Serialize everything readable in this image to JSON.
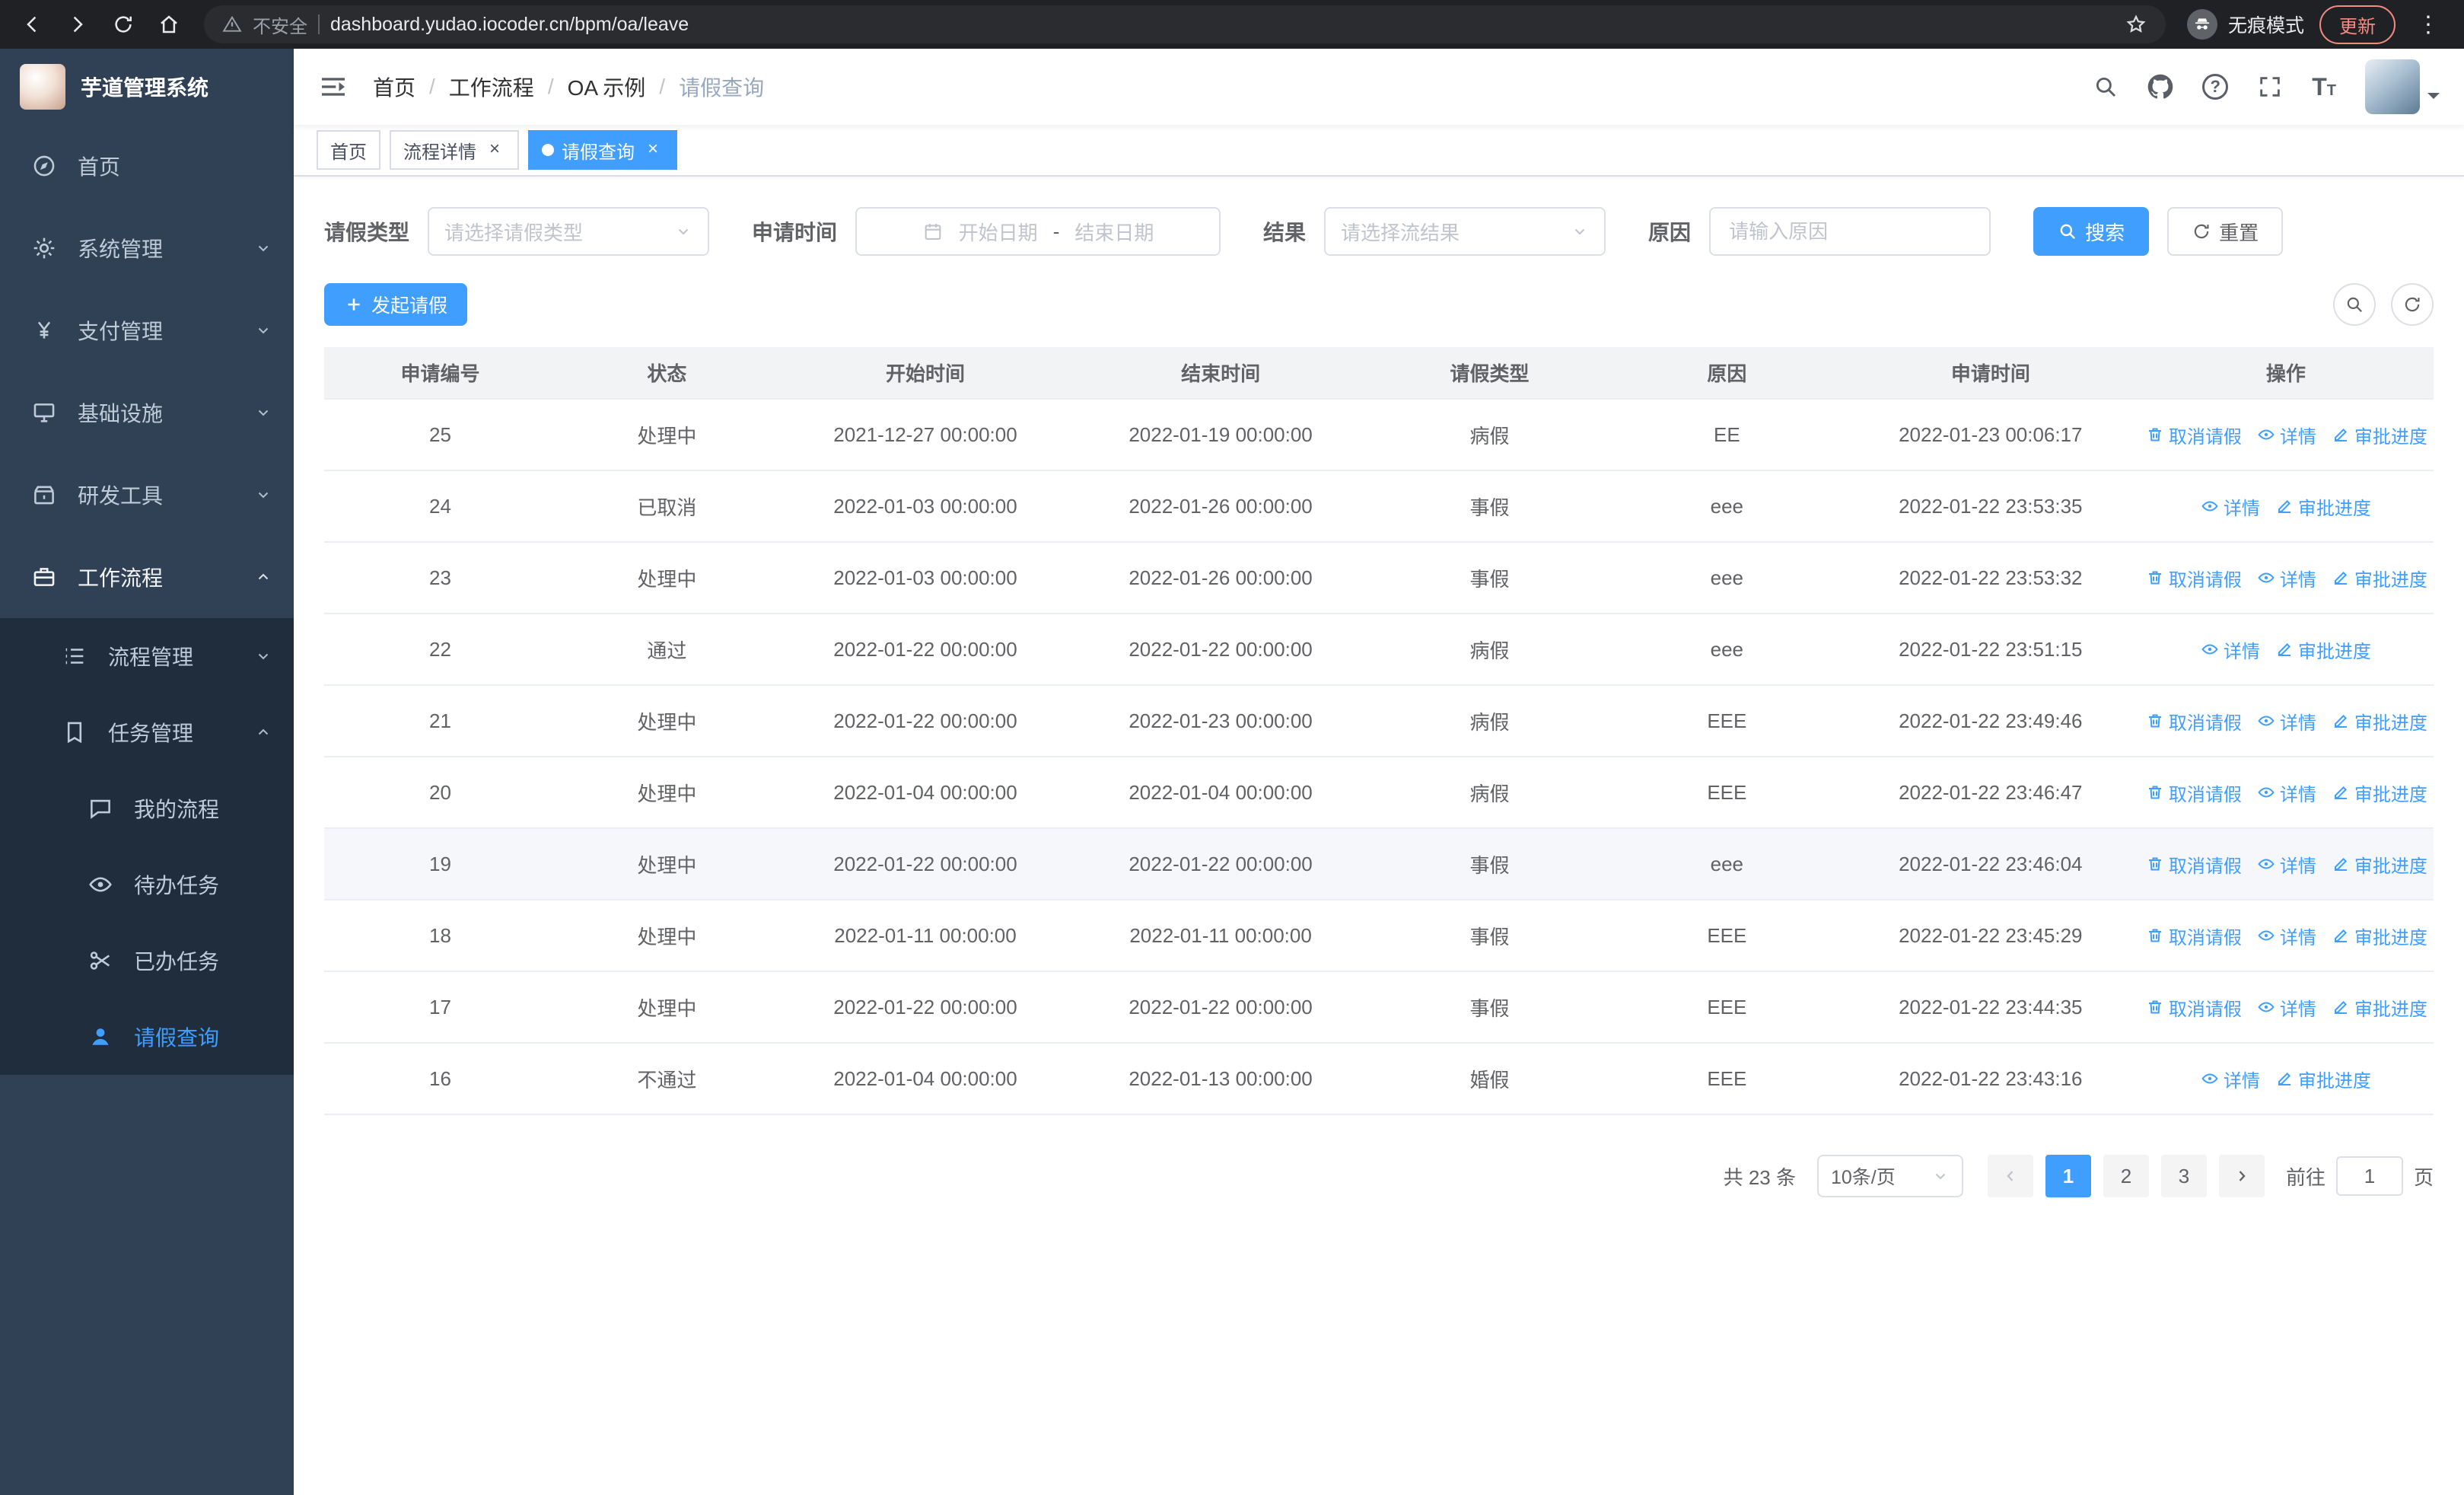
{
  "colors": {
    "primary": "#409EFF",
    "sidebar_bg": "#304156",
    "submenu_bg": "#1f2d3d"
  },
  "browser": {
    "security_warning": "不安全",
    "url": "dashboard.yudao.iocoder.cn/bpm/oa/leave",
    "incognito_label": "无痕模式",
    "update_button": "更新"
  },
  "sidebar": {
    "logo_title": "芋道管理系统",
    "items": [
      {
        "label": "首页",
        "level": 1,
        "icon": "home-icon"
      },
      {
        "label": "系统管理",
        "level": 1,
        "icon": "system-icon",
        "arrow": "down"
      },
      {
        "label": "支付管理",
        "level": 1,
        "icon": "payment-icon",
        "arrow": "down"
      },
      {
        "label": "基础设施",
        "level": 1,
        "icon": "infra-icon",
        "arrow": "down"
      },
      {
        "label": "研发工具",
        "level": 1,
        "icon": "devtools-icon",
        "arrow": "down"
      },
      {
        "label": "工作流程",
        "level": 1,
        "icon": "workflow-icon",
        "arrow": "up",
        "expanded": true
      },
      {
        "label": "流程管理",
        "level": 2,
        "icon": "process-icon",
        "arrow": "down"
      },
      {
        "label": "任务管理",
        "level": 2,
        "icon": "task-icon",
        "arrow": "up",
        "expanded": false
      },
      {
        "label": "我的流程",
        "level": 3,
        "icon": "my-process-icon"
      },
      {
        "label": "待办任务",
        "level": 3,
        "icon": "todo-icon"
      },
      {
        "label": "已办任务",
        "level": 3,
        "icon": "done-icon"
      },
      {
        "label": "请假查询",
        "level": 3,
        "icon": "leave-icon",
        "active": true
      }
    ]
  },
  "header": {
    "breadcrumbs": [
      "首页",
      "工作流程",
      "OA 示例",
      "请假查询"
    ]
  },
  "tabs": [
    {
      "label": "首页",
      "closable": false,
      "active": false
    },
    {
      "label": "流程详情",
      "closable": true,
      "active": false
    },
    {
      "label": "请假查询",
      "closable": true,
      "active": true
    }
  ],
  "filters": {
    "leave_type_label": "请假类型",
    "leave_type_placeholder": "请选择请假类型",
    "apply_time_label": "申请时间",
    "start_date_placeholder": "开始日期",
    "date_separator": "-",
    "end_date_placeholder": "结束日期",
    "result_label": "结果",
    "result_placeholder": "请选择流结果",
    "reason_label": "原因",
    "reason_placeholder": "请输入原因",
    "search_button": "搜索",
    "reset_button": "重置"
  },
  "toolbar": {
    "create_button": "发起请假"
  },
  "table": {
    "columns": [
      "申请编号",
      "状态",
      "开始时间",
      "结束时间",
      "请假类型",
      "原因",
      "申请时间",
      "操作"
    ],
    "action_labels": {
      "cancel": "取消请假",
      "detail": "详情",
      "progress": "审批进度"
    },
    "rows": [
      {
        "id": "25",
        "status": "处理中",
        "start": "2021-12-27 00:00:00",
        "end": "2022-01-19 00:00:00",
        "type": "病假",
        "reason": "EE",
        "apply_time": "2022-01-23 00:06:17",
        "actions": [
          "cancel",
          "detail",
          "progress"
        ],
        "highlight": false
      },
      {
        "id": "24",
        "status": "已取消",
        "start": "2022-01-03 00:00:00",
        "end": "2022-01-26 00:00:00",
        "type": "事假",
        "reason": "eee",
        "apply_time": "2022-01-22 23:53:35",
        "actions": [
          "detail",
          "progress"
        ],
        "highlight": false
      },
      {
        "id": "23",
        "status": "处理中",
        "start": "2022-01-03 00:00:00",
        "end": "2022-01-26 00:00:00",
        "type": "事假",
        "reason": "eee",
        "apply_time": "2022-01-22 23:53:32",
        "actions": [
          "cancel",
          "detail",
          "progress"
        ],
        "highlight": false
      },
      {
        "id": "22",
        "status": "通过",
        "start": "2022-01-22 00:00:00",
        "end": "2022-01-22 00:00:00",
        "type": "病假",
        "reason": "eee",
        "apply_time": "2022-01-22 23:51:15",
        "actions": [
          "detail",
          "progress"
        ],
        "highlight": false
      },
      {
        "id": "21",
        "status": "处理中",
        "start": "2022-01-22 00:00:00",
        "end": "2022-01-23 00:00:00",
        "type": "病假",
        "reason": "EEE",
        "apply_time": "2022-01-22 23:49:46",
        "actions": [
          "cancel",
          "detail",
          "progress"
        ],
        "highlight": false
      },
      {
        "id": "20",
        "status": "处理中",
        "start": "2022-01-04 00:00:00",
        "end": "2022-01-04 00:00:00",
        "type": "病假",
        "reason": "EEE",
        "apply_time": "2022-01-22 23:46:47",
        "actions": [
          "cancel",
          "detail",
          "progress"
        ],
        "highlight": false
      },
      {
        "id": "19",
        "status": "处理中",
        "start": "2022-01-22 00:00:00",
        "end": "2022-01-22 00:00:00",
        "type": "事假",
        "reason": "eee",
        "apply_time": "2022-01-22 23:46:04",
        "actions": [
          "cancel",
          "detail",
          "progress"
        ],
        "highlight": true
      },
      {
        "id": "18",
        "status": "处理中",
        "start": "2022-01-11 00:00:00",
        "end": "2022-01-11 00:00:00",
        "type": "事假",
        "reason": "EEE",
        "apply_time": "2022-01-22 23:45:29",
        "actions": [
          "cancel",
          "detail",
          "progress"
        ],
        "highlight": false
      },
      {
        "id": "17",
        "status": "处理中",
        "start": "2022-01-22 00:00:00",
        "end": "2022-01-22 00:00:00",
        "type": "事假",
        "reason": "EEE",
        "apply_time": "2022-01-22 23:44:35",
        "actions": [
          "cancel",
          "detail",
          "progress"
        ],
        "highlight": false
      },
      {
        "id": "16",
        "status": "不通过",
        "start": "2022-01-04 00:00:00",
        "end": "2022-01-13 00:00:00",
        "type": "婚假",
        "reason": "EEE",
        "apply_time": "2022-01-22 23:43:16",
        "actions": [
          "detail",
          "progress"
        ],
        "highlight": false
      }
    ]
  },
  "pagination": {
    "total_text": "共 23 条",
    "page_size": "10条/页",
    "pages": [
      "1",
      "2",
      "3"
    ],
    "active_page": "1",
    "goto_label": "前往",
    "goto_value": "1",
    "goto_suffix": "页"
  }
}
